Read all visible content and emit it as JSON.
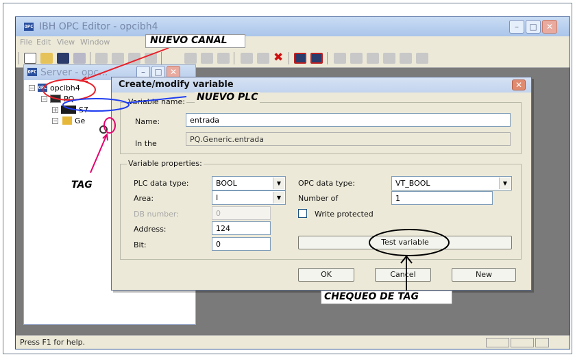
{
  "app": {
    "title": "IBH OPC Editor - opcibh4",
    "icon_label": "OPC",
    "menu": [
      "File",
      "Edit",
      "View",
      "Window"
    ],
    "status_text": "Press F1 for help."
  },
  "server_window": {
    "title": "Server - opc...",
    "tree": {
      "root": "opcibh4",
      "plc": "PQ",
      "device": "S7",
      "group": "Ge"
    }
  },
  "dialog": {
    "title": "Create/modify variable",
    "name_group": {
      "legend": "Variable name:",
      "name_label": "Name:",
      "name_value": "entrada",
      "in_the_label": "In the",
      "in_the_value": "PQ.Generic.entrada"
    },
    "props_group": {
      "legend": "Variable properties:",
      "plc_type_label": "PLC data type:",
      "plc_type_value": "BOOL",
      "area_label": "Area:",
      "area_value": "I",
      "db_label": "DB number:",
      "db_value": "0",
      "address_label": "Address:",
      "address_value": "124",
      "bit_label": "Bit:",
      "bit_value": "0",
      "opc_type_label": "OPC data type:",
      "opc_type_value": "VT_BOOL",
      "number_of_label": "Number of",
      "number_of_value": "1",
      "write_protected_label": "Write protected",
      "test_button": "Test variable"
    },
    "buttons": {
      "ok": "OK",
      "cancel": "Cancel",
      "new": "New"
    }
  },
  "annotations": {
    "nuevo_canal": "NUEVO CANAL",
    "nuevo_plc": "NUEVO PLC",
    "tag": "TAG",
    "chequeo": "CHEQUEO DE TAG",
    "red": "#e8202a",
    "blue": "#1e3cf0",
    "magenta": "#e4006e",
    "black": "#000000"
  }
}
